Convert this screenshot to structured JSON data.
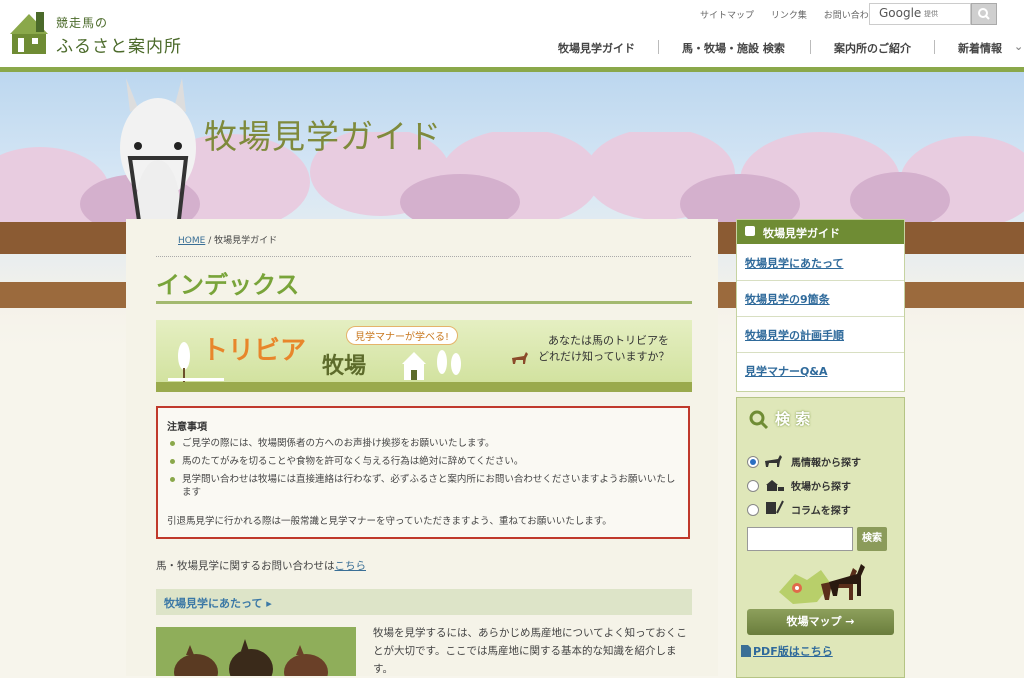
{
  "header": {
    "logo_small": "競走馬の",
    "logo_big": "ふるさと案内所",
    "util_links": [
      "サイトマップ",
      "リンク集",
      "お問い合わせ"
    ],
    "google_label": "Google",
    "google_sub": "提供",
    "nav": [
      "牧場見学ガイド",
      "馬・牧場・施設 検索",
      "案内所のご紹介",
      "新着情報"
    ]
  },
  "banner": {
    "title": "牧場見学ガイド"
  },
  "breadcrumb": {
    "home": "HOME",
    "sep": "/",
    "current": "牧場見学ガイド"
  },
  "main": {
    "title": "インデックス",
    "trivia": {
      "logo": "トリビア",
      "logo2": "牧場",
      "tag": "見学マナーが学べる!",
      "q1": "あなたは馬のトリビアを",
      "q2": "どれだけ知っていますか？"
    },
    "notice": {
      "title": "注意事項",
      "items": [
        "ご見学の際には、牧場関係者の方へのお声掛け挨拶をお願いいたします。",
        "馬のたてがみを切ることや食物を許可なく与える行為は絶対に辞めてください。",
        "見学問い合わせは牧場には直接連絡は行わなず、必ずふるさと案内所にお問い合わせくださいますようお願いいたします"
      ],
      "footer": "引退馬見学に行かれる際は一般常識と見学マナーを守っていただきますよう、重ねてお願いいたします。"
    },
    "contact_text": "馬・牧場見学に関するお問い合わせは",
    "contact_link": "こちら",
    "section_head": "牧場見学にあたって ▸",
    "intro": "牧場を見学するには、あらかじめ馬産地についてよく知っておくことが大切です。ここでは馬産地に関する基本的な知識を紹介します。"
  },
  "sidebar": {
    "guide_title": "牧場見学ガイド",
    "guide_items": [
      "牧場見学にあたって",
      "牧場見学の9箇条",
      "牧場見学の計画手順",
      "見学マナーQ&A"
    ],
    "search_title": "検 索",
    "radios": [
      {
        "label": "馬情報から探す",
        "checked": true
      },
      {
        "label": "牧場から探す",
        "checked": false
      },
      {
        "label": "コラムを探す",
        "checked": false
      }
    ],
    "search_button": "検索",
    "map_button": "牧場マップ →",
    "pdf_link": "PDF版はこちら"
  },
  "colors": {
    "accent": "#79a43a",
    "nav_green": "#6f8c34",
    "alert": "#c0392b",
    "link": "#2f6a9b"
  }
}
